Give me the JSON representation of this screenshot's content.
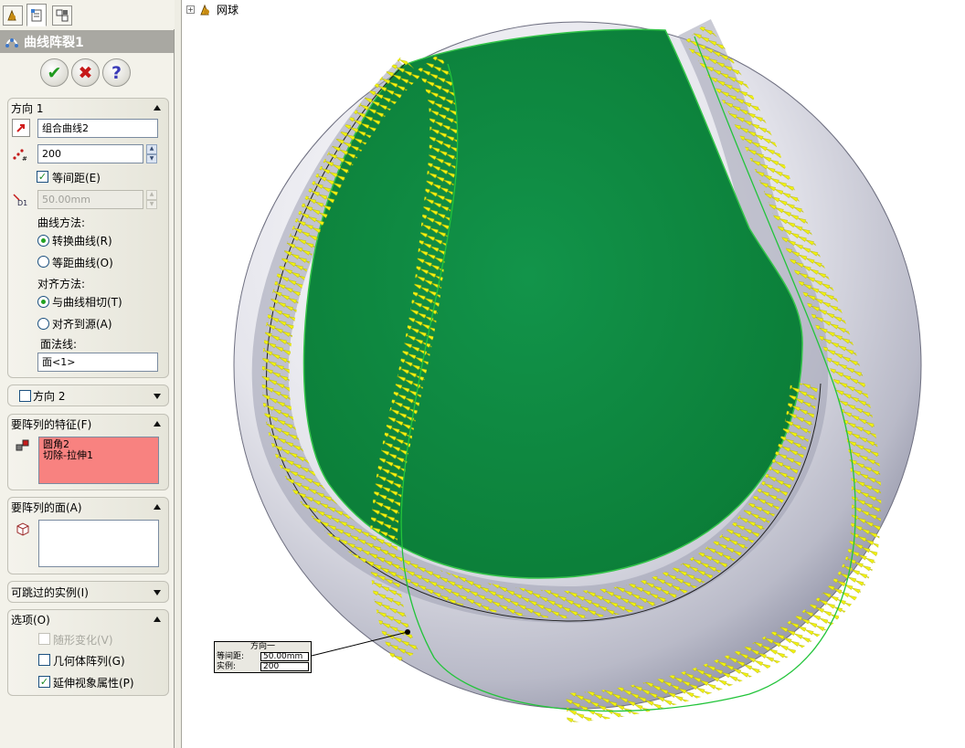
{
  "panel": {
    "title": "曲线阵裂1",
    "tabs": [
      "feature-manager",
      "property-manager",
      "configuration-manager"
    ],
    "buttons": {
      "ok": "✔",
      "cancel": "✖",
      "help": "?"
    },
    "direction1": {
      "header": "方向 1",
      "curve_value": "组合曲线2",
      "instances_value": "200",
      "equal_spacing_label": "等间距(E)",
      "equal_spacing_checked": true,
      "spacing_value": "50.00mm",
      "curve_method_label": "曲线方法:",
      "curve_method_options": [
        "转换曲线(R)",
        "等距曲线(O)"
      ],
      "align_method_label": "对齐方法:",
      "align_method_options": [
        "与曲线相切(T)",
        "对齐到源(A)"
      ],
      "face_normal_label": "面法线:",
      "face_normal_value": "面<1>"
    },
    "direction2": {
      "header": "方向 2"
    },
    "features": {
      "header": "要阵列的特征(F)",
      "items": [
        "圆角2",
        "切除-拉伸1"
      ]
    },
    "faces": {
      "header": "要阵列的面(A)"
    },
    "skip": {
      "header": "可跳过的实例(I)"
    },
    "options": {
      "header": "选项(O)",
      "vary_sketch": "随形变化(V)",
      "geometry_pattern": "几何体阵列(G)",
      "propagate_visual": "延伸视象属性(P)"
    }
  },
  "viewport": {
    "tree_label": "网球",
    "callout": {
      "title": "方向一",
      "spacing_label": "等间距:",
      "spacing_value": "50.00mm",
      "instances_label": "实例:",
      "instances_value": "200"
    }
  },
  "colors": {
    "ball_green": "#0d8a3e",
    "pattern_yellow": "#f3f312",
    "ball_white": "#e8e8ee",
    "panel_bg": "#f3f2ea",
    "selection_pink": "#f88280"
  }
}
